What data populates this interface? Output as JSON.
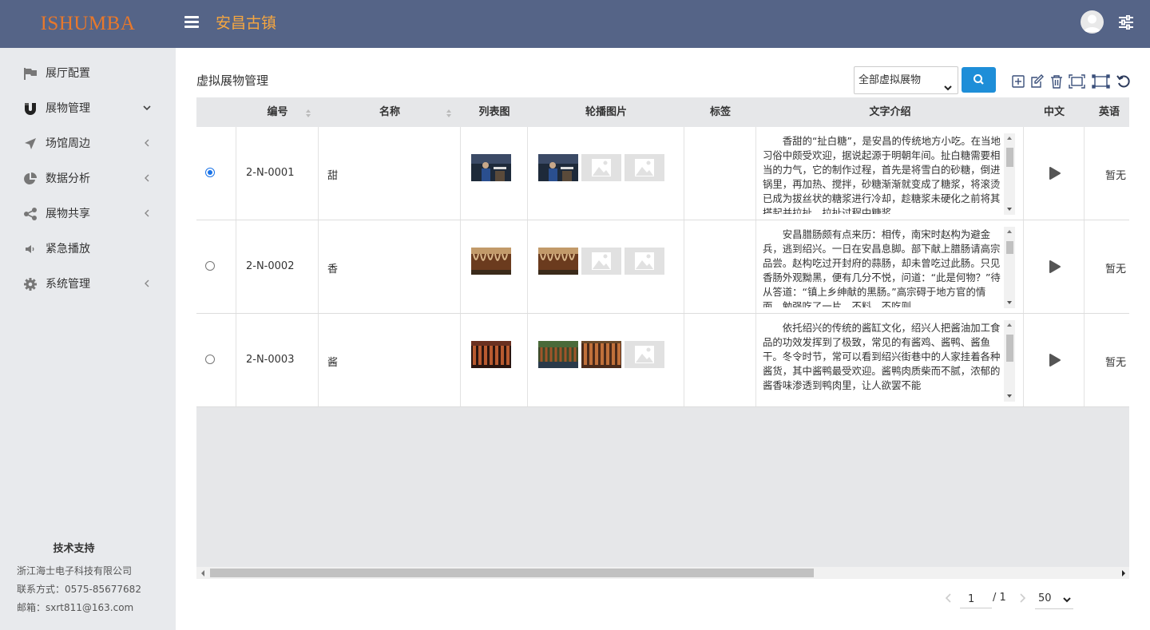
{
  "header": {
    "logo": "ISHUMBA",
    "site_title": "安昌古镇"
  },
  "sidebar": {
    "items": [
      {
        "label": "展厅配置",
        "icon": "flag-icon",
        "arrow": ""
      },
      {
        "label": "展物管理",
        "icon": "magnet-icon",
        "arrow": "down"
      },
      {
        "label": "场馆周边",
        "icon": "location-arrow-icon",
        "arrow": "left"
      },
      {
        "label": "数据分析",
        "icon": "pie-chart-icon",
        "arrow": "left"
      },
      {
        "label": "展物共享",
        "icon": "share-icon",
        "arrow": "left"
      },
      {
        "label": "紧急播放",
        "icon": "speaker-icon",
        "arrow": ""
      },
      {
        "label": "系统管理",
        "icon": "gear-icon",
        "arrow": "left"
      }
    ],
    "support": {
      "title": "技术支持",
      "company": "浙江海士电子科技有限公司",
      "phone": "联系方式：0575-85677682",
      "email": "邮箱：sxrt811@163.com"
    }
  },
  "main": {
    "title": "虚拟展物管理",
    "filter_value": "全部虚拟展物",
    "toolbar": [
      "add-icon",
      "edit-icon",
      "delete-icon",
      "expand-icon",
      "crop-icon",
      "refresh-icon"
    ]
  },
  "table": {
    "columns": [
      "编号",
      "名称",
      "列表图",
      "轮播图片",
      "标签",
      "文字介绍",
      "中文",
      "英语"
    ],
    "rows": [
      {
        "selected": true,
        "code": "2-N-0001",
        "name": "甜",
        "carousel": [
          "photo",
          "placeholder",
          "placeholder"
        ],
        "tag": "",
        "description": "香甜的“扯白糖”，是安昌的传统地方小吃。在当地习俗中颇受欢迎，据说起源于明朝年间。扯白糖需要相当的力气，它的制作过程，首先是将雪白的砂糖，倒进锅里，再加热、搅拌，砂糖渐渐就变成了糖浆，将滚烫已成为拔丝状的糖浆进行冷却，趁糖浆未硬化之前将其搭起并拉扯，拉扯过程中糖浆",
        "audio_cn": "play",
        "english": "暂无"
      },
      {
        "selected": false,
        "code": "2-N-0002",
        "name": "香",
        "carousel": [
          "photo",
          "placeholder",
          "placeholder"
        ],
        "tag": "",
        "description": "安昌腊肠颇有点来历：相传，南宋时赵构为避金兵，逃到绍兴。一日在安昌息脚。部下献上腊肠请高宗品尝。赵构吃过开封府的蒜肠，却未曾吃过此肠。只见香肠外观黝黑，便有几分不悦，问道：“此是何物？”待从答道：“镇上乡绅献的黑肠。”高宗碍于地方官的情面，勉强吃了一片，不料，不吃则",
        "audio_cn": "play",
        "english": "暂无"
      },
      {
        "selected": false,
        "code": "2-N-0003",
        "name": "酱",
        "carousel": [
          "photo",
          "photo",
          "placeholder"
        ],
        "tag": "",
        "description": "依托绍兴的传统的酱缸文化，绍兴人把酱油加工食品的功效发挥到了极致，常见的有酱鸡、酱鸭、酱鱼干。冬令时节，常可以看到绍兴街巷中的人家挂着各种酱货，其中酱鸭最受欢迎。酱鸭肉质柴而不腻，浓郁的酱香味渗透到鸭肉里，让人欲罢不能",
        "audio_cn": "play",
        "english": "暂无"
      }
    ]
  },
  "pagination": {
    "current": "1",
    "separator": "/ 1",
    "page_size": "50"
  },
  "colors": {
    "header_bg": "#556487",
    "logo": "#e8782b",
    "site_title": "#f5a640",
    "sidebar_bg": "#e8eaed",
    "primary": "#1e8ed8"
  }
}
